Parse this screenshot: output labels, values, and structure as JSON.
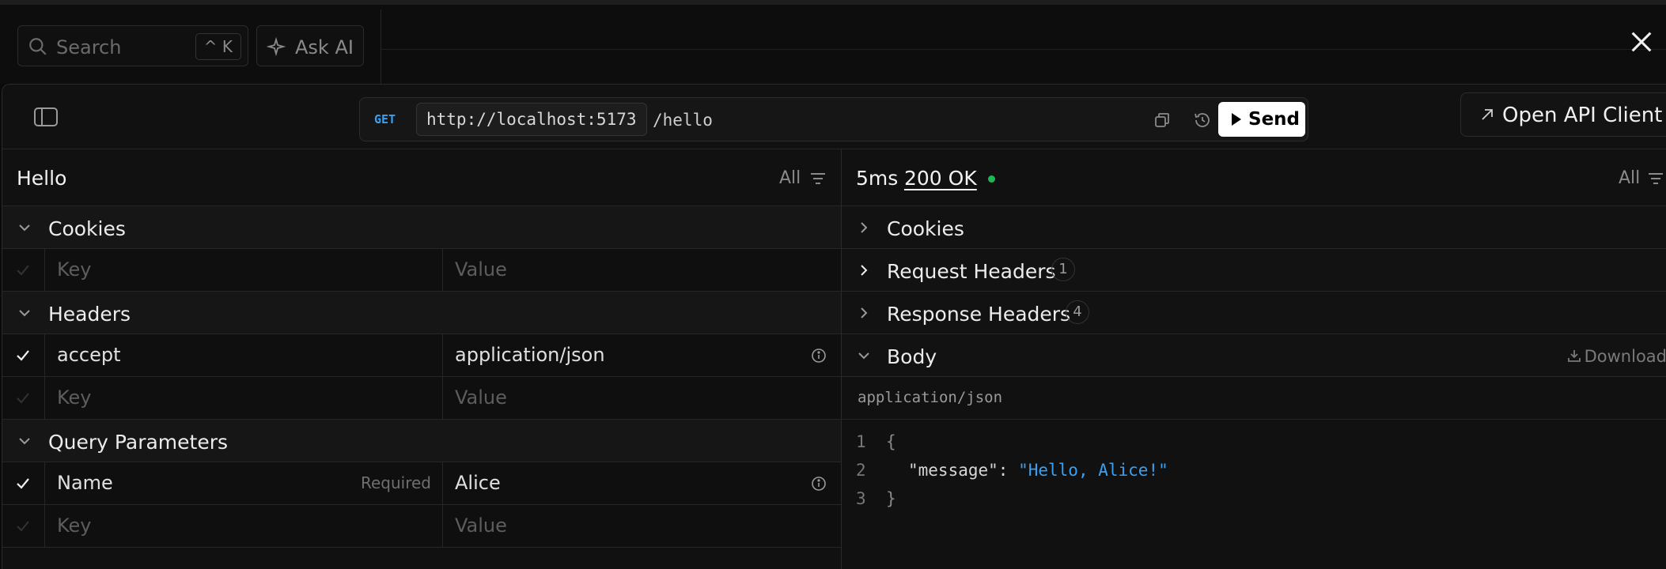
{
  "search": {
    "placeholder": "Search",
    "shortcut": "^ K"
  },
  "ask_ai": {
    "label": "Ask AI"
  },
  "request": {
    "method": "GET",
    "server": "http://localhost:5173",
    "path": "/hello",
    "send_label": "Send"
  },
  "open_client_label": "Open API Client",
  "left_pane": {
    "title": "Hello",
    "filter_label": "All",
    "sections": {
      "cookies": "Cookies",
      "headers": "Headers",
      "query": "Query Parameters"
    },
    "key_placeholder": "Key",
    "value_placeholder": "Value",
    "headers_rows": [
      {
        "key": "accept",
        "value": "application/json"
      }
    ],
    "query_rows": [
      {
        "key": "Name",
        "required": "Required",
        "value": "Alice"
      }
    ]
  },
  "right_pane": {
    "time": "5ms",
    "status": "200 OK",
    "filter_label": "All",
    "sections": {
      "cookies": "Cookies",
      "request_headers": "Request Headers",
      "request_headers_count": "1",
      "response_headers": "Response Headers",
      "response_headers_count": "4",
      "body": "Body",
      "download": "Download"
    },
    "content_type": "application/json",
    "body_lines": [
      {
        "n": "1",
        "open": "{"
      },
      {
        "n": "2",
        "key": "\"message\"",
        "sep": ": ",
        "value": "\"Hello, Alice!\""
      },
      {
        "n": "3",
        "close": "}"
      }
    ]
  },
  "colors": {
    "accent": "#3aa0f2",
    "status_ok": "#1db954",
    "send_bg": "#ffffff"
  },
  "icons": [
    "search-icon",
    "sparkle-icon",
    "close-icon",
    "sidebar-icon",
    "copy-icon",
    "history-icon",
    "play-icon",
    "external-arrow-icon",
    "filter-icon",
    "chevron-down-icon",
    "chevron-right-icon",
    "check-icon",
    "info-icon",
    "download-icon"
  ]
}
